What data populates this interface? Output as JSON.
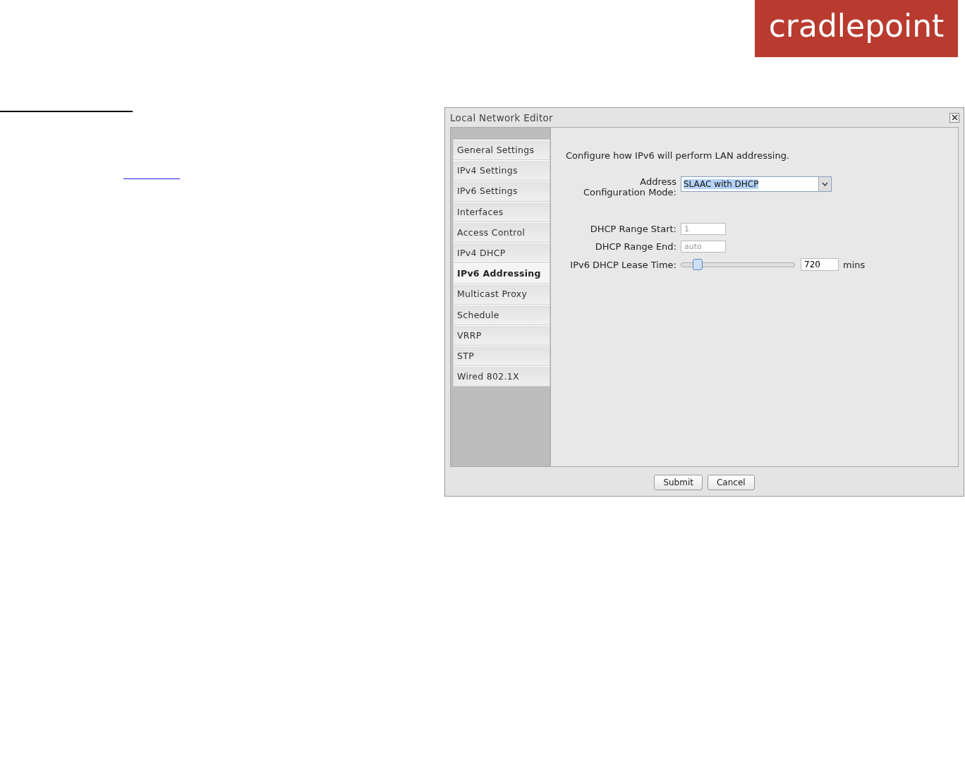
{
  "logo": {
    "text": "cradlepoint"
  },
  "window": {
    "title": "Local Network Editor"
  },
  "tabs": [
    {
      "label": "General Settings",
      "selected": false
    },
    {
      "label": "IPv4 Settings",
      "selected": false
    },
    {
      "label": "IPv6 Settings",
      "selected": false
    },
    {
      "label": "Interfaces",
      "selected": false
    },
    {
      "label": "Access Control",
      "selected": false
    },
    {
      "label": "IPv4 DHCP",
      "selected": false
    },
    {
      "label": "IPv6 Addressing",
      "selected": true
    },
    {
      "label": "Multicast Proxy",
      "selected": false
    },
    {
      "label": "Schedule",
      "selected": false
    },
    {
      "label": "VRRP",
      "selected": false
    },
    {
      "label": "STP",
      "selected": false
    },
    {
      "label": "Wired 802.1X",
      "selected": false
    }
  ],
  "intro": "Configure how IPv6 will perform LAN addressing.",
  "fields": [
    {
      "kind": "select",
      "label": "Address Configuration Mode:",
      "value": "SLAAC with DHCP"
    },
    {
      "kind": "text",
      "label": "DHCP Range Start:",
      "placeholder": "1"
    },
    {
      "kind": "text",
      "label": "DHCP Range End:",
      "placeholder": "auto"
    },
    {
      "kind": "slider",
      "label": "IPv6 DHCP Lease Time:",
      "level": 0.11,
      "value": "720",
      "unit": "mins"
    }
  ],
  "buttons": [
    "Submit",
    "Cancel"
  ]
}
